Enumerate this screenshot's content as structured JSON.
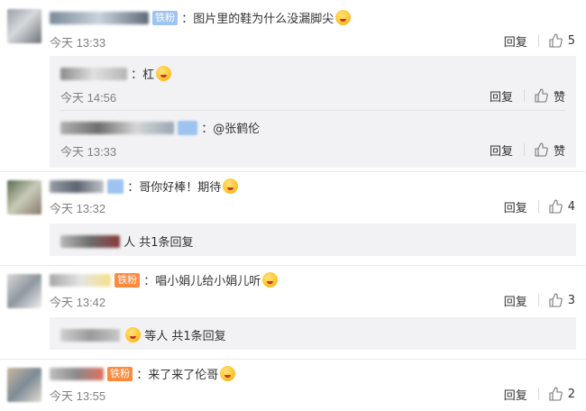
{
  "comments": [
    {
      "text": "：图片里的鞋为什么没漏脚尖",
      "badge": "铁粉",
      "time": "今天 13:33",
      "reply_label": "回复",
      "likes": "5",
      "replies": [
        {
          "text": "：杠",
          "time": "今天 14:56",
          "reply_label": "回复",
          "like_label": "赞"
        },
        {
          "text": "：@张鹤伦",
          "time": "今天 13:33",
          "reply_label": "回复",
          "like_label": "赞"
        }
      ]
    },
    {
      "text": "：哥你好棒！期待",
      "time": "今天 13:32",
      "reply_label": "回复",
      "likes": "4",
      "more": "人 共1条回复"
    },
    {
      "text": "：唱小娟儿给小娟儿听",
      "badge": "铁粉",
      "time": "今天 13:42",
      "reply_label": "回复",
      "likes": "3",
      "more": "等人 共1条回复"
    },
    {
      "text": "：来了来了伦哥",
      "badge": "铁粉",
      "time": "今天 13:55",
      "reply_label": "回复",
      "likes": "2"
    }
  ],
  "colors": {
    "badge_orange": "#ff8a3d",
    "badge_blue": "#9ec3f0",
    "reply_box": "#f2f2f5",
    "time_gray": "#808080"
  },
  "icons": {
    "like": "thumbs-up-icon",
    "emoji": "emoji-icon"
  }
}
